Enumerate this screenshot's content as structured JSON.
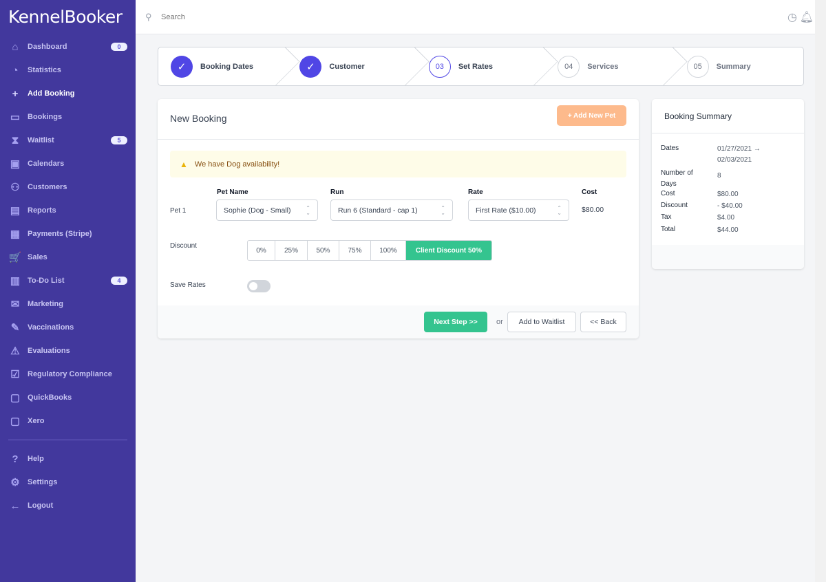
{
  "app": {
    "name": "KennelBooker"
  },
  "sidebar": {
    "items": [
      {
        "label": "Dashboard",
        "icon": "home-icon",
        "glyph": "⌂",
        "badge": "0"
      },
      {
        "label": "Statistics",
        "icon": "pie-chart-icon",
        "glyph": "◔"
      },
      {
        "label": "Add Booking",
        "icon": "plus-icon",
        "glyph": "+",
        "active": true
      },
      {
        "label": "Bookings",
        "icon": "folder-icon",
        "glyph": "▭"
      },
      {
        "label": "Waitlist",
        "icon": "hourglass-icon",
        "glyph": "⧗",
        "badge": "5"
      },
      {
        "label": "Calendars",
        "icon": "calendar-icon",
        "glyph": "▣"
      },
      {
        "label": "Customers",
        "icon": "users-icon",
        "glyph": "⚇"
      },
      {
        "label": "Reports",
        "icon": "bar-chart-icon",
        "glyph": "▤"
      },
      {
        "label": "Payments (Stripe)",
        "icon": "cash-icon",
        "glyph": "▦"
      },
      {
        "label": "Sales",
        "icon": "cart-icon",
        "glyph": "🛒"
      },
      {
        "label": "To-Do List",
        "icon": "clipboard-icon",
        "glyph": "▥",
        "badge": "4"
      },
      {
        "label": "Marketing",
        "icon": "mail-icon",
        "glyph": "✉"
      },
      {
        "label": "Vaccinations",
        "icon": "syringe-icon",
        "glyph": "✎"
      },
      {
        "label": "Evaluations",
        "icon": "warning-icon",
        "glyph": "⚠"
      },
      {
        "label": "Regulatory Compliance",
        "icon": "clipboard-check-icon",
        "glyph": "☑"
      },
      {
        "label": "QuickBooks",
        "icon": "briefcase-icon",
        "glyph": "▢"
      },
      {
        "label": "Xero",
        "icon": "briefcase-icon",
        "glyph": "▢"
      }
    ],
    "bottom": [
      {
        "label": "Help",
        "icon": "help-icon",
        "glyph": "?"
      },
      {
        "label": "Settings",
        "icon": "gear-icon",
        "glyph": "⚙"
      },
      {
        "label": "Logout",
        "icon": "arrow-left-icon",
        "glyph": "←"
      }
    ]
  },
  "topbar": {
    "search_placeholder": "Search"
  },
  "steps": [
    {
      "num": "✓",
      "label": "Booking Dates",
      "state": "done"
    },
    {
      "num": "✓",
      "label": "Customer",
      "state": "done"
    },
    {
      "num": "03",
      "label": "Set Rates",
      "state": "current"
    },
    {
      "num": "04",
      "label": "Services",
      "state": "todo"
    },
    {
      "num": "05",
      "label": "Summary",
      "state": "todo"
    }
  ],
  "booking": {
    "title": "New Booking",
    "add_pet": "+ Add New Pet",
    "alert": "We have Dog availability!",
    "headers": {
      "pet": "Pet Name",
      "run": "Run",
      "rate": "Rate",
      "cost": "Cost"
    },
    "pet_label": "Pet 1",
    "pet": "Sophie (Dog - Small)",
    "run": "Run 6 (Standard - cap 1)",
    "rate": "First Rate ($10.00)",
    "cost": "$80.00",
    "discount_label": "Discount",
    "discounts": [
      "0%",
      "25%",
      "50%",
      "75%",
      "100%",
      "Client Discount 50%"
    ],
    "discount_selected": "Client Discount 50%",
    "save_rates_label": "Save Rates",
    "save_rates": false,
    "next": "Next Step >>",
    "or": "or",
    "waitlist": "Add to Waitlist",
    "back": "<< Back"
  },
  "summary": {
    "title": "Booking Summary",
    "rows": [
      {
        "label": "Dates",
        "value": "01/27/2021 → 02/03/2021"
      },
      {
        "label": "Number of Days",
        "value": "8"
      },
      {
        "label": "Cost",
        "value": "$80.00"
      },
      {
        "label": "Discount",
        "value": "- $40.00"
      },
      {
        "label": "Tax",
        "value": "$4.00"
      },
      {
        "label": "Total",
        "value": "$44.00"
      }
    ]
  },
  "colors": {
    "sidebar": "#42389d",
    "accent": "#5046e5",
    "success": "#34c48f",
    "orange": "#fdba8c"
  }
}
